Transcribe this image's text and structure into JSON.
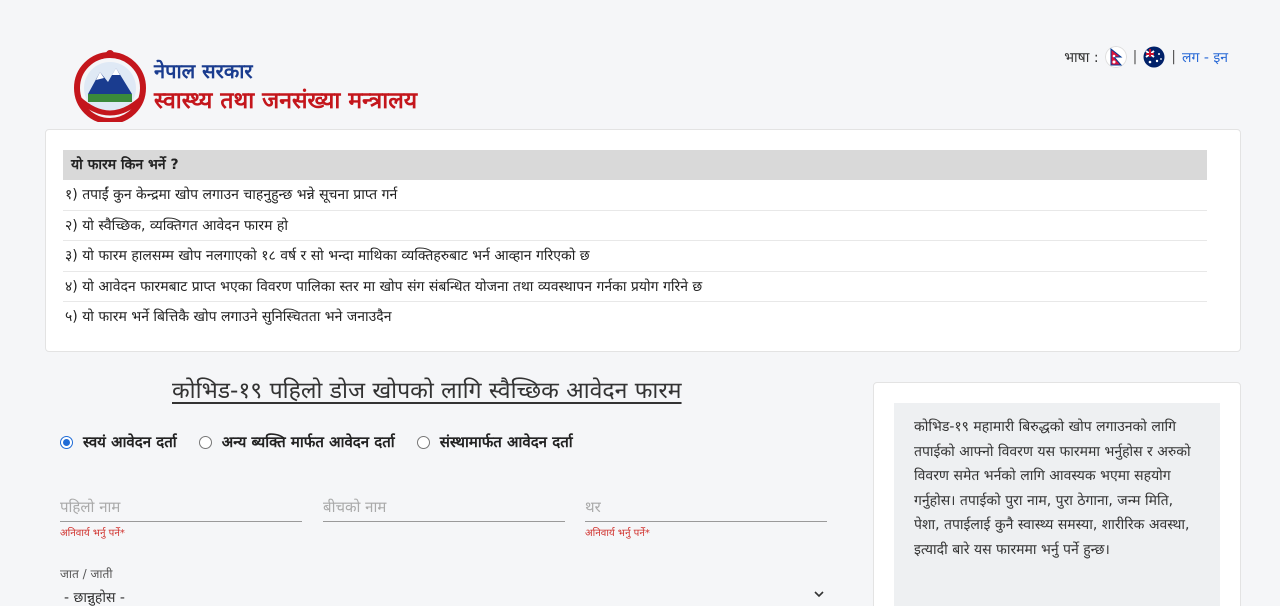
{
  "header": {
    "gov_name": "नेपाल सरकार",
    "ministry_name": "स्वास्थ्य तथा जनसंख्या मन्त्रालय",
    "language_label": "भाषा :",
    "separator": "|",
    "login_link": "लग - इन",
    "icons": [
      "nepal-emblem-icon",
      "nepal-flag-icon",
      "australia-flag-icon"
    ]
  },
  "info": {
    "heading": "यो फारम किन भर्ने ?",
    "rows": [
      "१) तपाईं कुन केन्द्रमा खोप लगाउन चाहनुहुन्छ भन्ने सूचना प्राप्त गर्न",
      "२) यो स्वैच्छिक, व्यक्तिगत आवेदन फारम हो",
      "३) यो फारम हालसम्म खोप नलगाएको १८ वर्ष र सो भन्दा माथिका व्यक्तिहरुबाट भर्न आव्हान गरिएको छ",
      "४) यो आवेदन फारमबाट प्राप्त भएका विवरण पालिका स्तर मा खोप संग संबन्धित योजना तथा व्यवस्थापन गर्नका प्रयोग गरिने छ",
      "५) यो फारम भर्ने बित्तिकै खोप लगाउने सुनिस्चितता भने जनाउदैन"
    ]
  },
  "form": {
    "title": "कोभिड-१९ पहिलो डोज खोपको लागि स्वैच्छिक आवेदन फारम",
    "radio_self": "स्वयं आवेदन दर्ता",
    "radio_other": "अन्य ब्यक्ति मार्फत आवेदन दर्ता",
    "radio_org": "संस्थामार्फत आवेदन दर्ता",
    "selected_radio": "स्वयं आवेदन दर्ता",
    "first_name_placeholder": "पहिलो नाम",
    "middle_name_placeholder": "बीचको नाम",
    "last_name_placeholder": "थर",
    "required_note": "अनिवार्य भर्नु पर्ने*",
    "caste_label": "जात / जाती",
    "caste_value": "- छान्नुहोस -"
  },
  "side": {
    "text": "कोभिड-१९ महामारी बिरुद्धको खोप लगाउनको लागि तपाईको आफ्नो विवरण यस फारममा भर्नुहोस र अरुको विवरण समेत भर्नको लागि आवस्यक भएमा सहयोग गर्नुहोस। तपाईको पुरा नाम, पुरा ठेगाना, जन्म मिति, पेशा, तपाईलाई कुनै स्वास्थ्य समस्या, शारीरिक अवस्था, इत्यादी बारे यस फारममा भर्नु पर्ने हुन्छ।"
  },
  "colors": {
    "ministry_red": "#c4161c",
    "gov_blue": "#1a3c8f",
    "link_blue": "#2a6ad6",
    "radio_blue": "#1f6bd6",
    "required_red": "#d0312d"
  }
}
